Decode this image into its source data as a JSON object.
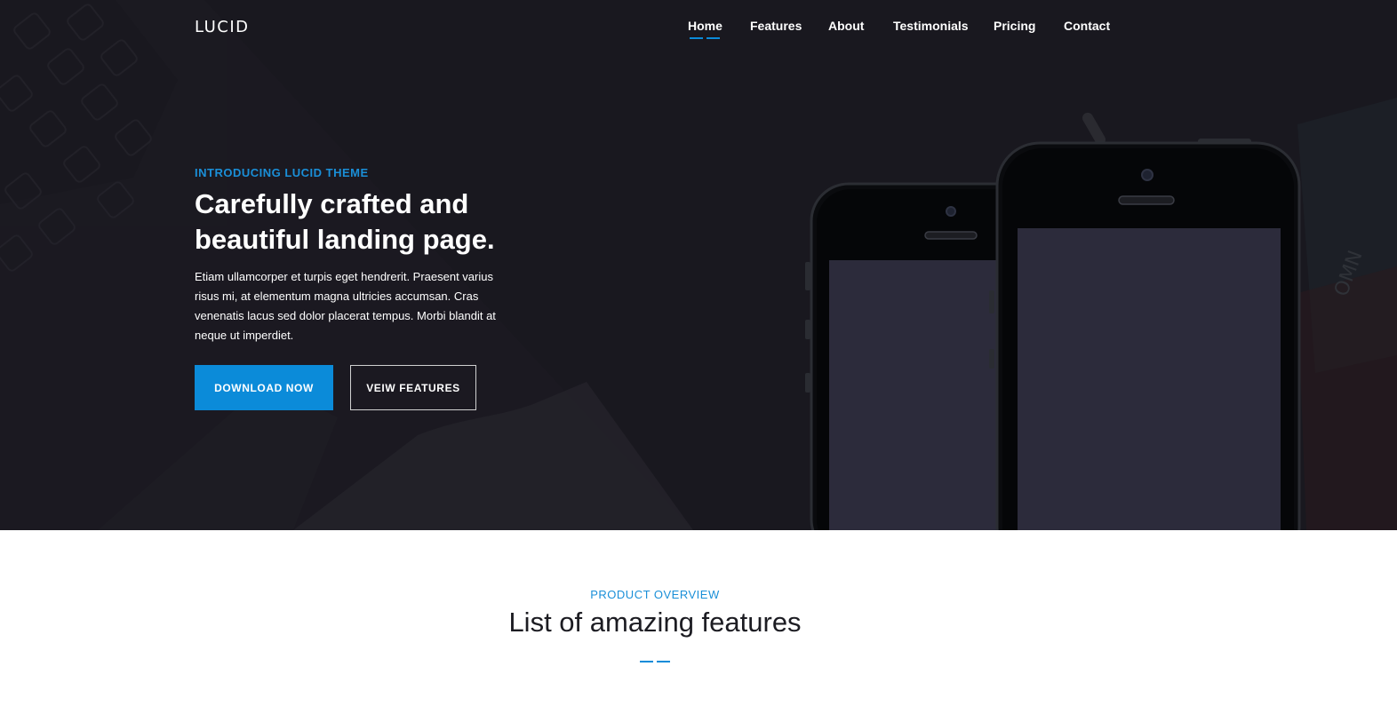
{
  "brand": "LUCID",
  "nav": {
    "items": [
      {
        "label": "Home",
        "active": true
      },
      {
        "label": "Features"
      },
      {
        "label": "About"
      },
      {
        "label": "Testimonials"
      },
      {
        "label": "Pricing"
      },
      {
        "label": "Contact"
      }
    ]
  },
  "hero": {
    "eyebrow": "INTRODUCING LUCID THEME",
    "headline": "Carefully crafted and beautiful landing page.",
    "lead": "Etiam ullamcorper et turpis eget hendrerit. Praesent varius risus mi, at elementum magna ultricies accumsan. Cras venenatis lacus sed dolor placerat tempus. Morbi blandit at neque ut imperdiet.",
    "primary_button": "DOWNLOAD NOW",
    "secondary_button": "VEIW FEATURES"
  },
  "section": {
    "eyebrow": "PRODUCT OVERVIEW",
    "title": "List of amazing features"
  },
  "colors": {
    "accent": "#0b8bd9",
    "hero_bg": "#19181f",
    "phone_screen": "#2c2b3b"
  }
}
